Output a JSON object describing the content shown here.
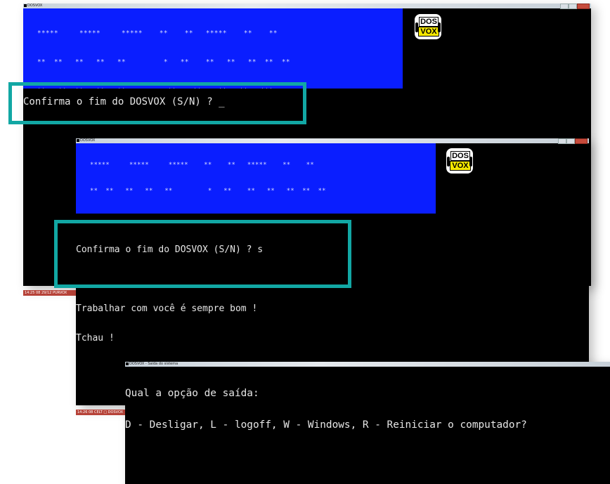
{
  "windows": {
    "w1": {
      "title": "DOSVOX"
    },
    "w2": {
      "title": "DOSVOX"
    },
    "w3": {
      "title": "DOSVOX - Saída do sistema"
    }
  },
  "banner_lines": [
    "*****     *****     *****    **    **   *****    **    **",
    "**  **   **   **   **         *   **    **   **   **  **  **",
    "**   **  **   **   **          **    **    **   **   ***",
    "**   **  **   **   *****   **    **    **   **    *",
    "**   **  **   **      **     ** **     **   **   ***",
    "**  **   **   **  *   **      ***      **   **   **  **",
    "*****     *****     *****      *       *****    **    **"
  ],
  "logo": {
    "top": "DOS",
    "bottom": "VOX"
  },
  "w1_prompt": "Confirma o fim do DOSVOX (S/N) ? _",
  "w2_lines": [
    "Confirma o fim do DOSVOX (S/N) ? s",
    "",
    "Trabalhar com você é sempre bom !",
    "Tchau !"
  ],
  "w3_lines": [
    "Qual a opção de saída:",
    "D - Desligar, L - logoff, W - Windows, R - Reiniciar o computador?"
  ],
  "taskbar": {
    "t1": "14:25 08 29/12    PURVOX",
    "t2": "14:26 08 CELT  □  DOSVOX"
  },
  "colors": {
    "banner_blue": "#0a1eff",
    "highlight": "#12a7a4",
    "terminal_bg": "#000000"
  }
}
